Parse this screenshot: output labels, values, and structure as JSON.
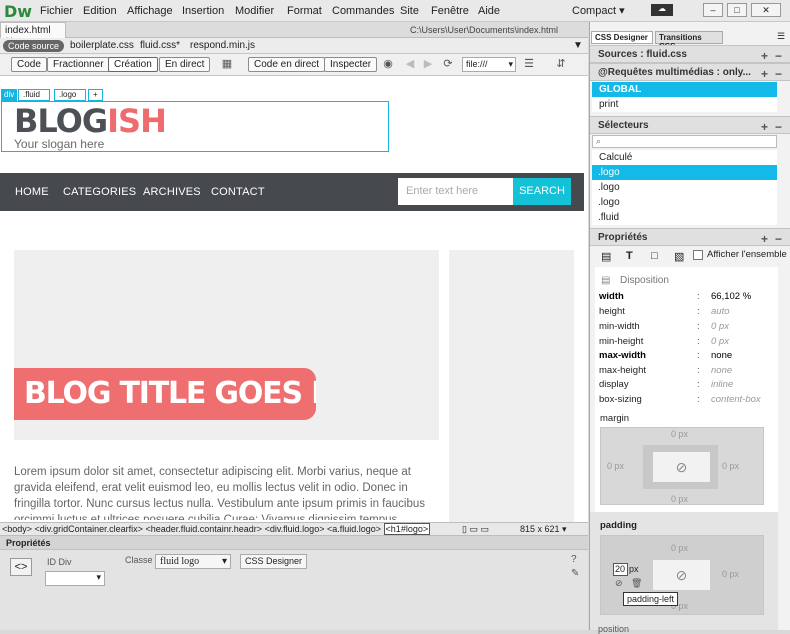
{
  "app": {
    "logo": "Dw",
    "menus": [
      "Fichier",
      "Edition",
      "Affichage",
      "Insertion",
      "Modifier",
      "Format",
      "Commandes",
      "Site",
      "Fenêtre",
      "Aide"
    ],
    "workspace": "Compact",
    "win_buttons": [
      "–",
      "□",
      "✕"
    ]
  },
  "document": {
    "tab": "index.html",
    "path": "C:\\Users\\User\\Documents\\index.html"
  },
  "related_files": [
    "Code source",
    "boilerplate.css",
    "fluid.css*",
    "respond.min.js"
  ],
  "toolbar": {
    "views": [
      "Code",
      "Fractionner",
      "Création",
      "En direct"
    ],
    "live_code": "Code en direct",
    "inspect": "Inspecter",
    "url": "file:///"
  },
  "selection": {
    "tag": "div",
    "chips": [
      ".fluid",
      ".logo",
      "+"
    ]
  },
  "page": {
    "logo_part1": "BLOG",
    "logo_part2": "ISH",
    "slogan": "Your slogan here",
    "nav": [
      "HOME",
      "CATEGORIES",
      "ARCHIVES",
      "CONTACT"
    ],
    "search_placeholder": "Enter text here",
    "search_button": "SEARCH",
    "banner": "BLOG TITLE GOES HERE",
    "lorem": "Lorem ipsum dolor sit amet, consectetur adipiscing elit. Morbi varius, neque at gravida eleifend, erat velit euismod leo, eu mollis lectus velit in odio. Donec in fringilla tortor. Nunc cursus lectus nulla. Vestibulum ante ipsum primis in faucibus orcimmi luctus et ultrices posuere cubilia Curae; Vivamus dignissim tempus"
  },
  "tag_selector": {
    "tags": [
      "<body>",
      "<div.gridContainer.clearfix>",
      "<header.fluid.containr.headr>",
      "<div.fluid.logo>",
      "<a.fluid.logo>"
    ],
    "current": "<h1#logo>",
    "window_size": "815 x 621"
  },
  "properties": {
    "title": "Propriétés",
    "id_label": "ID Div",
    "class_label": "Classe",
    "class_value": "fluid logo",
    "css_button": "CSS Designer"
  },
  "css_designer": {
    "tabs": [
      "CSS Designer",
      "Transitions CSS"
    ],
    "sources_label": "Sources : fluid.css",
    "media_label": "@Requêtes multimédias : only...",
    "media_items": [
      "GLOBAL",
      "print"
    ],
    "selectors_label": "Sélecteurs",
    "selectors": [
      "Calculé",
      ".logo",
      ".logo",
      ".logo",
      ".fluid"
    ],
    "properties_label": "Propriétés",
    "show_all": "Afficher l'ensemble",
    "layout_label": "Disposition",
    "rows": [
      {
        "k": "width",
        "v": "66,102 %"
      },
      {
        "k": "height",
        "v": "auto"
      },
      {
        "k": "min-width",
        "v": "0 px"
      },
      {
        "k": "min-height",
        "v": "0 px"
      },
      {
        "k": "max-width",
        "v": "none"
      },
      {
        "k": "max-height",
        "v": "none"
      },
      {
        "k": "display",
        "v": "inline"
      },
      {
        "k": "box-sizing",
        "v": "content-box"
      }
    ],
    "margin_label": "margin",
    "margin_values": [
      "0 px",
      "0 px",
      "0 px",
      "0 px"
    ],
    "padding_label": "padding",
    "padding_values": [
      "0 px",
      "0 px",
      "0 px"
    ],
    "padding_left_input": "20",
    "padding_unit": "px",
    "tooltip": "padding-left",
    "position_label": "position"
  }
}
